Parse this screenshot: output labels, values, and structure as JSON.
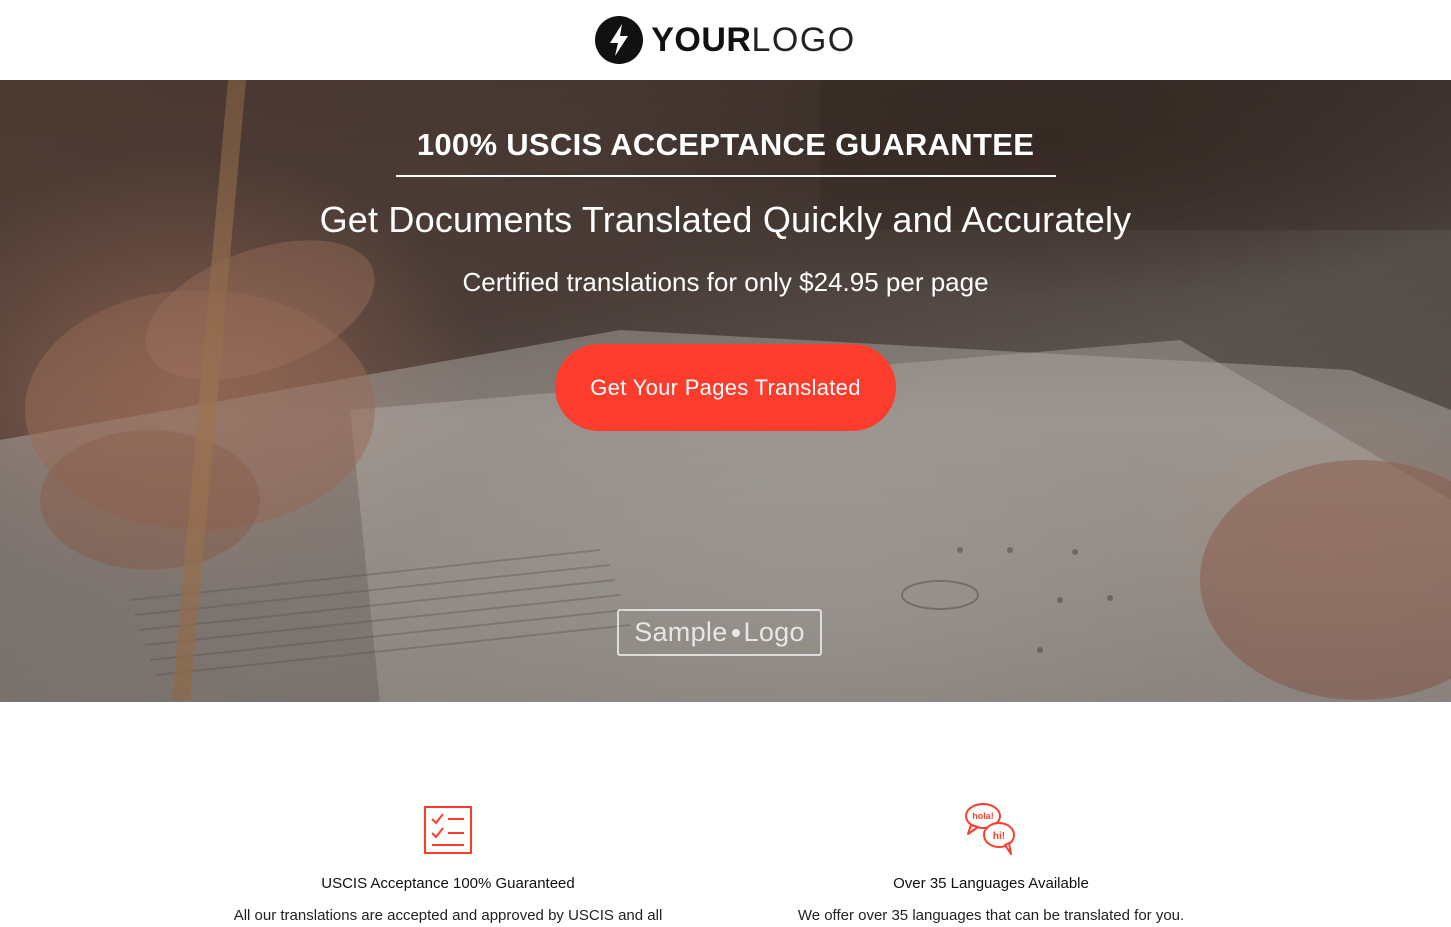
{
  "header": {
    "logo_bold": "YOUR",
    "logo_light": "LOGO",
    "logo_icon": "lightning-bolt-icon"
  },
  "hero": {
    "guarantee": "100% USCIS ACCEPTANCE GUARANTEE",
    "headline": "Get Documents Translated Quickly and Accurately",
    "subhead": "Certified translations for only $24.95 per page",
    "cta_label": "Get Your Pages Translated",
    "sample_logo_left": "Sample",
    "sample_logo_right": "Logo"
  },
  "features": [
    {
      "icon": "checklist-icon",
      "title": "USCIS Acceptance 100% Guaranteed",
      "description": "All our translations are accepted and approved by USCIS and all"
    },
    {
      "icon": "speech-bubbles-icon",
      "icon_text_1": "hola!",
      "icon_text_2": "hi!",
      "title": "Over 35 Languages Available",
      "description": "We offer over 35 languages that can be translated for you."
    }
  ],
  "colors": {
    "accent": "#fc3c2c",
    "text_dark": "#111111"
  }
}
